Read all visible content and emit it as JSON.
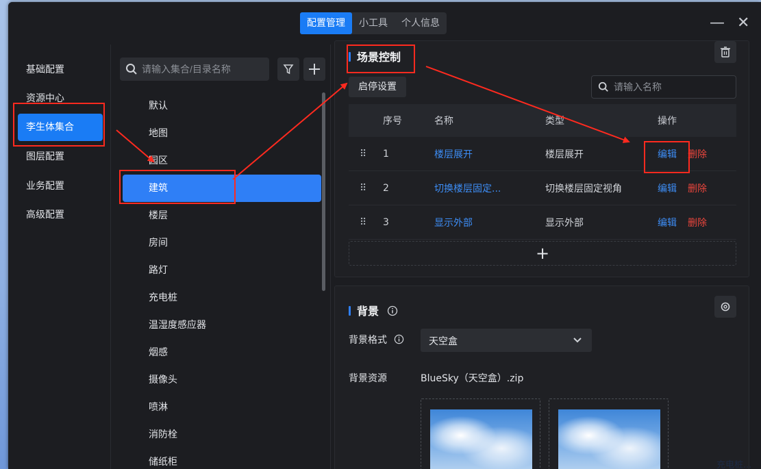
{
  "tabs": [
    {
      "label": "配置管理",
      "active": true
    },
    {
      "label": "小工具",
      "active": false
    },
    {
      "label": "个人信息",
      "active": false
    }
  ],
  "window_controls": {
    "minimize": "—",
    "close": "✕"
  },
  "sidebar": {
    "items": [
      {
        "label": "基础配置",
        "active": false
      },
      {
        "label": "资源中心",
        "active": false
      },
      {
        "label": "李生体集合",
        "active": true
      },
      {
        "label": "图层配置",
        "active": false
      },
      {
        "label": "业务配置",
        "active": false
      },
      {
        "label": "高级配置",
        "active": false
      }
    ]
  },
  "tree": {
    "search_placeholder": "请输入集合/目录名称",
    "nodes": [
      {
        "label": "默认"
      },
      {
        "label": "地图"
      },
      {
        "label": "园区"
      },
      {
        "label": "建筑",
        "active": true
      },
      {
        "label": "楼层"
      },
      {
        "label": "房间"
      },
      {
        "label": "路灯"
      },
      {
        "label": "充电桩"
      },
      {
        "label": "温湿度感应器"
      },
      {
        "label": "烟感"
      },
      {
        "label": "摄像头"
      },
      {
        "label": "喷淋"
      },
      {
        "label": "消防栓"
      },
      {
        "label": "储纸柜"
      }
    ]
  },
  "scene": {
    "title": "场景控制",
    "start_stop_label": "启停设置",
    "search_placeholder": "请输入名称",
    "headers": {
      "index": "序号",
      "name": "名称",
      "type": "类型",
      "ops": "操作"
    },
    "rows": [
      {
        "index": "1",
        "name": "楼层展开",
        "type": "楼层展开",
        "edit": "编辑",
        "del": "删除"
      },
      {
        "index": "2",
        "name": "切换楼层固定...",
        "type": "切换楼层固定视角",
        "edit": "编辑",
        "del": "删除"
      },
      {
        "index": "3",
        "name": "显示外部",
        "type": "显示外部",
        "edit": "编辑",
        "del": "删除"
      }
    ],
    "add_symbol": "+"
  },
  "background": {
    "title": "背景",
    "format_label": "背景格式",
    "format_value": "天空盒",
    "resource_label": "背景资源",
    "resource_value": "BlueSky（天空盒）.zip"
  },
  "taskbar_text": "充电桩...",
  "colors": {
    "accent": "#1a7cf5",
    "danger": "#e8453c",
    "annotation": "#ff2a1f"
  }
}
